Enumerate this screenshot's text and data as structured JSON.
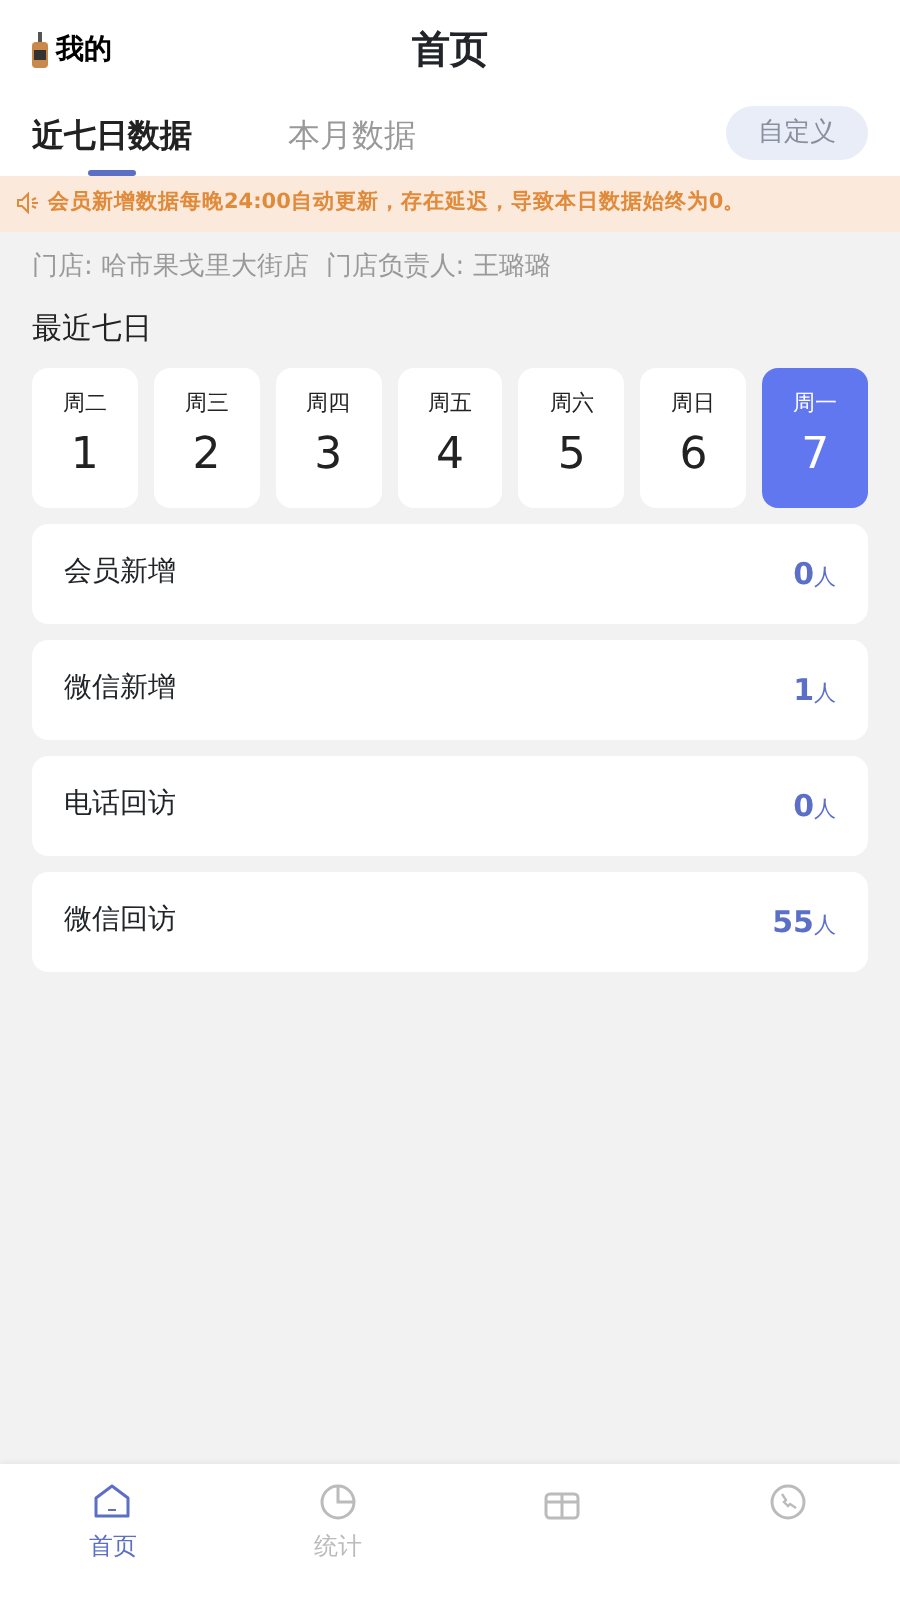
{
  "header": {
    "back_label": "我的",
    "title": "首页"
  },
  "tabs": [
    {
      "label": "近七日数据",
      "selected": true
    },
    {
      "label": "本月数据",
      "selected": false
    }
  ],
  "custom_button": "自定义",
  "notice": "会员新增数据每晚24:00自动更新，存在延迟，导致本日数据始终为0。",
  "store_info": "门店: 哈市果戈里大街店  门店负责人: 王璐璐",
  "section_title": "最近七日",
  "days": [
    {
      "weekday": "周二",
      "date": "1",
      "selected": false
    },
    {
      "weekday": "周三",
      "date": "2",
      "selected": false
    },
    {
      "weekday": "周四",
      "date": "3",
      "selected": false
    },
    {
      "weekday": "周五",
      "date": "4",
      "selected": false
    },
    {
      "weekday": "周六",
      "date": "5",
      "selected": false
    },
    {
      "weekday": "周日",
      "date": "6",
      "selected": false
    },
    {
      "weekday": "周一",
      "date": "7",
      "selected": true
    }
  ],
  "stats": [
    {
      "label": "会员新增",
      "value": "0",
      "unit": "人"
    },
    {
      "label": "微信新增",
      "value": "1",
      "unit": "人"
    },
    {
      "label": "电话回访",
      "value": "0",
      "unit": "人"
    },
    {
      "label": "微信回访",
      "value": "55",
      "unit": "人"
    }
  ],
  "bottom_nav": [
    {
      "kind": "home",
      "label": "首页",
      "selected": true
    },
    {
      "kind": "chart",
      "label": "统计",
      "selected": false
    },
    {
      "kind": "gift",
      "selected": false
    },
    {
      "kind": "phone",
      "selected": false
    }
  ]
}
